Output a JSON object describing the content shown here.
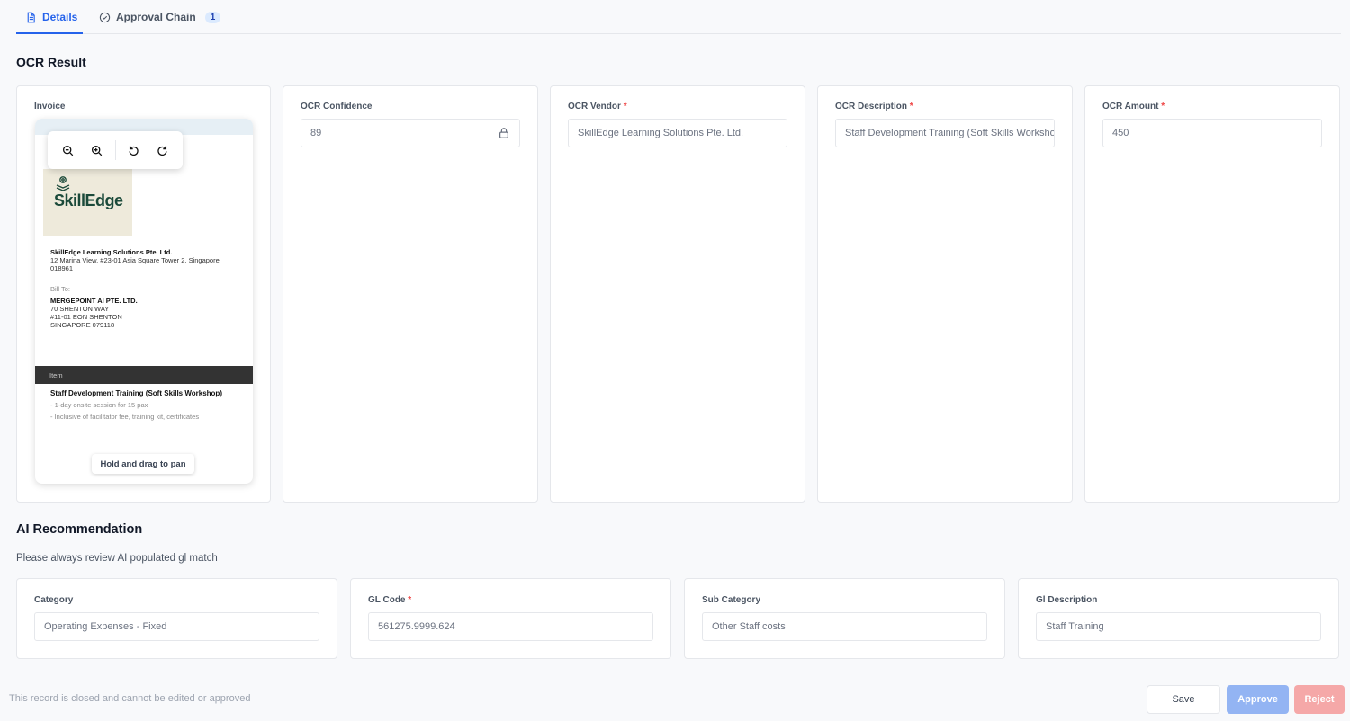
{
  "tabs": {
    "details": "Details",
    "approval_chain": "Approval Chain",
    "approval_count": "1"
  },
  "ocr": {
    "section_title": "OCR Result",
    "invoice_label": "Invoice",
    "confidence_label": "OCR Confidence",
    "confidence_value": "89",
    "vendor_label": "OCR Vendor",
    "vendor_value": "SkillEdge Learning Solutions Pte. Ltd.",
    "description_label": "OCR Description",
    "description_value": "Staff Development Training (Soft Skills Workshop)",
    "amount_label": "OCR Amount",
    "amount_value": "450",
    "required_mark": "*"
  },
  "invoice": {
    "logo_text": "SkillEdge",
    "vendor_name": "SkillEdge Learning Solutions Pte. Ltd.",
    "vendor_addr_1": "12 Marina View, #23-01 Asia Square Tower 2, Singapore",
    "vendor_addr_2": "018961",
    "bill_to_label": "Bill To:",
    "bill_to_name": "MERGEPOINT AI PTE. LTD.",
    "bill_to_addr_1": "70 SHENTON WAY",
    "bill_to_addr_2": "#11-01 EON SHENTON",
    "bill_to_addr_3": "SINGAPORE 079118",
    "item_header": "Item",
    "item_title": "Staff Development Training (Soft Skills Workshop)",
    "item_line_1": "- 1-day onsite session for 15 pax",
    "item_line_2": "- Inclusive of facilitator fee, training kit, certificates",
    "pan_hint": "Hold and drag to pan"
  },
  "ai": {
    "section_title": "AI Recommendation",
    "subtitle": "Please always review AI populated gl match",
    "category_label": "Category",
    "category_value": "Operating Expenses - Fixed",
    "gl_code_label": "GL Code",
    "gl_code_value": "561275.9999.624",
    "sub_category_label": "Sub Category",
    "sub_category_value": "Other Staff costs",
    "gl_description_label": "Gl Description",
    "gl_description_value": "Staff Training"
  },
  "footer": {
    "note": "This record is closed and cannot be edited or approved",
    "save": "Save",
    "approve": "Approve",
    "reject": "Reject"
  },
  "colors": {
    "accent": "#2563eb",
    "approve_disabled": "#93b4f3",
    "reject_disabled": "#f5a8a8",
    "required": "#ef4444"
  }
}
